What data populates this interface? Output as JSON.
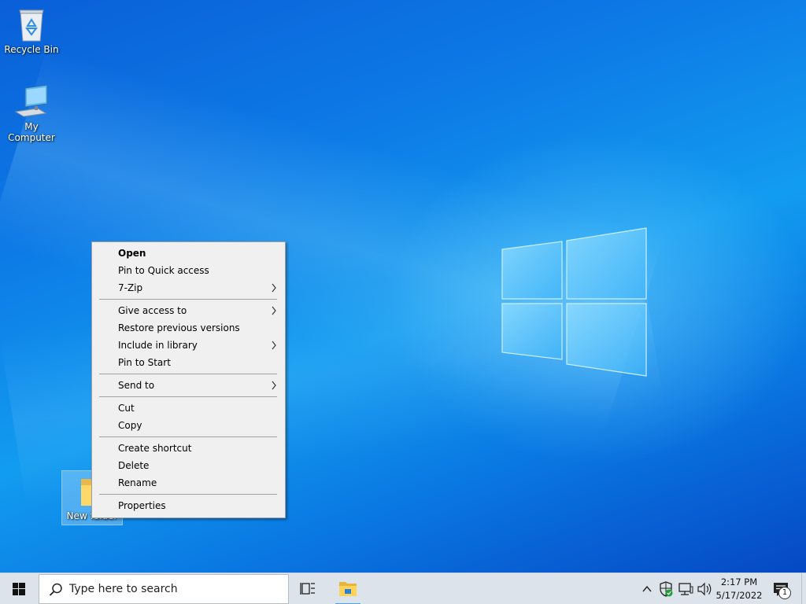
{
  "desktop": {
    "icons": [
      {
        "label": "Recycle Bin",
        "icon": "recycle-bin-icon"
      },
      {
        "label": "My Computer",
        "icon": "computer-icon"
      },
      {
        "label": "New folder",
        "icon": "folder-icon",
        "selected": true
      }
    ]
  },
  "context_menu": {
    "items": [
      {
        "label": "Open",
        "bold": true
      },
      {
        "label": "Pin to Quick access"
      },
      {
        "label": "7-Zip",
        "submenu": true
      },
      {
        "label": "Give access to",
        "submenu": true
      },
      {
        "label": "Restore previous versions"
      },
      {
        "label": "Include in library",
        "submenu": true
      },
      {
        "label": "Pin to Start"
      },
      {
        "label": "Send to",
        "submenu": true
      },
      {
        "label": "Cut"
      },
      {
        "label": "Copy"
      },
      {
        "label": "Create shortcut"
      },
      {
        "label": "Delete"
      },
      {
        "label": "Rename"
      },
      {
        "label": "Properties"
      }
    ]
  },
  "taskbar": {
    "search_placeholder": "Type here to search",
    "time": "2:17 PM",
    "date": "5/17/2022",
    "notification_count": "1",
    "pinned": [
      "task-view-icon",
      "file-explorer-icon"
    ],
    "tray_icons": [
      "chevron-up-icon",
      "defender-shield-icon",
      "network-icon",
      "volume-icon"
    ]
  },
  "colors": {
    "accent": "#0078d7",
    "desktop_blue": "#0d7be6",
    "menu_background": "#f0f0f0",
    "taskbar_background": "#dde3ea"
  }
}
